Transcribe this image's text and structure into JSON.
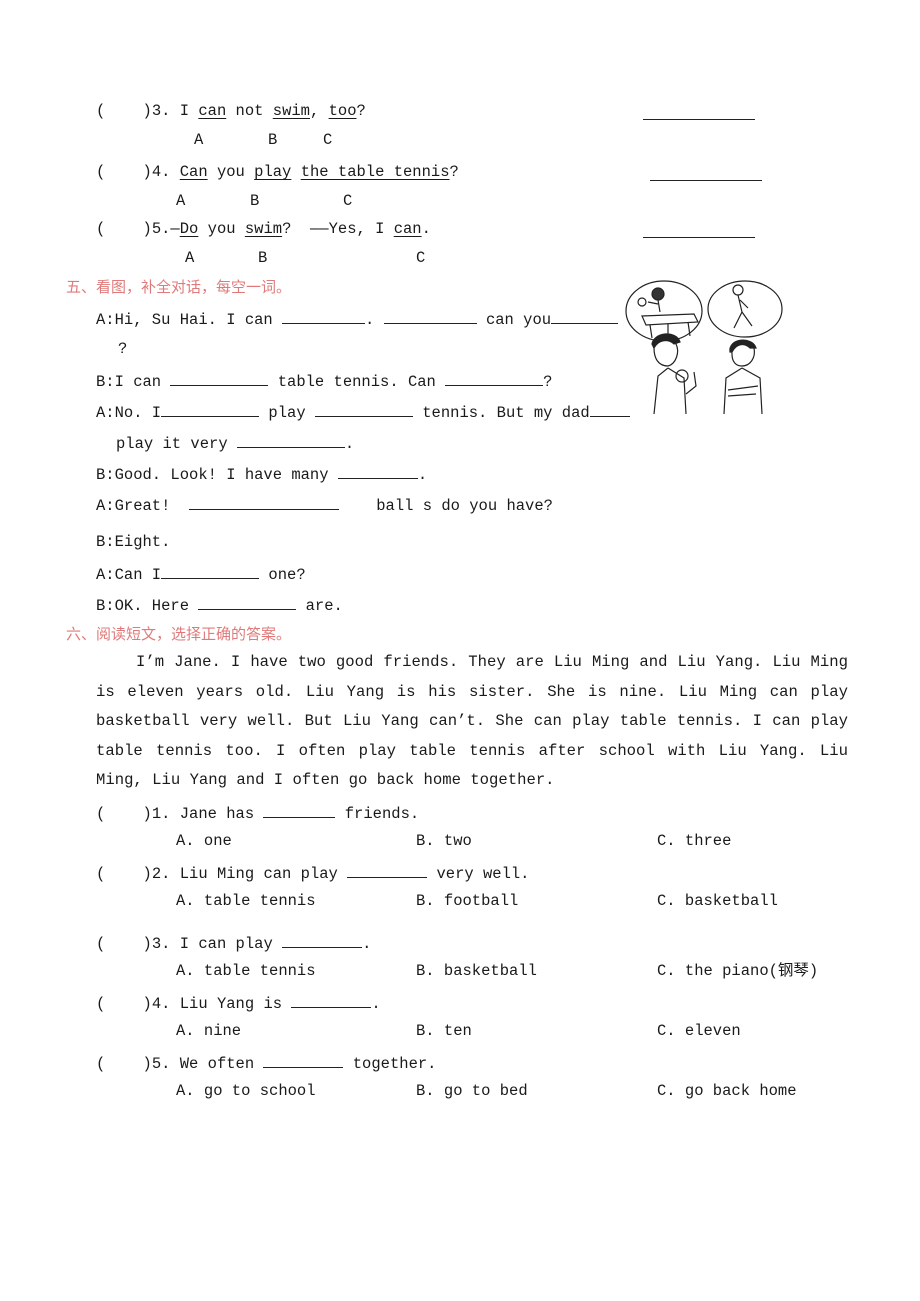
{
  "section4": {
    "items": [
      {
        "paren": "(    )",
        "num": "3.",
        "parts": [
          "I ",
          "can",
          " not ",
          "swim",
          ", ",
          "too",
          "?"
        ],
        "letters": [
          "A",
          "B",
          "C"
        ]
      },
      {
        "paren": "(    )",
        "num": "4.",
        "parts": [
          "Can",
          " you ",
          "play",
          " ",
          "the table tennis",
          "?"
        ],
        "letters": [
          "A",
          "B",
          "C"
        ]
      },
      {
        "paren": "(    )",
        "num": "5.",
        "parts": [
          "—",
          "Do",
          " you ",
          "swim",
          "?  ——Yes, I ",
          "can",
          "."
        ],
        "letters": [
          "A",
          "B",
          "C"
        ]
      }
    ]
  },
  "section5": {
    "heading": "五、看图，补全对话，每空一词。",
    "lines": {
      "l1a": "A:Hi, Su Hai. I can ",
      "l1b": ". ",
      "l1c": " can you",
      "l1d": "?",
      "l2a": "B:I can ",
      "l2b": " table tennis. Can ",
      "l2c": "?",
      "l3a": "A:No. I",
      "l3b": " play ",
      "l3c": " tennis. But my dad",
      "l4a": "play it very ",
      "l4b": ".",
      "l5a": "B:Good. Look! I have many ",
      "l5b": ".",
      "l6a": "A:Great!  ",
      "l6b": "    ball s do you have?",
      "l7": "B:Eight.",
      "l8a": "A:Can I",
      "l8b": " one?",
      "l9a": "B:OK. Here ",
      "l9b": " are."
    },
    "picture": "illustration of girl playing table tennis, boy running, girl holding ball, boy with arms crossed"
  },
  "section6": {
    "heading": "六、阅读短文，选择正确的答案。",
    "passage": "I’m Jane. I have two good friends. They are Liu Ming and Liu Yang. Liu Ming is eleven years old. Liu Yang is his sister. She is nine. Liu Ming can play basketball very well. But Liu Yang can’t. She can play table tennis. I can play table tennis too. I often play table tennis after school with Liu Yang. Liu Ming, Liu Yang and I often go back home together.",
    "questions": [
      {
        "paren": "(    )",
        "num": "1.",
        "before": "Jane has ",
        "after": " friends.",
        "options": [
          "A. one",
          "B. two",
          "C. three"
        ]
      },
      {
        "paren": "(    )",
        "num": "2.",
        "before": "Liu Ming can play ",
        "after": " very well.",
        "options": [
          "A. table tennis",
          "B. football",
          "C. basketball"
        ]
      },
      {
        "paren": "(    )",
        "num": "3.",
        "before": "I can play ",
        "after": ".",
        "options": [
          "A. table tennis",
          "B. basketball",
          "C. the piano(钢琴)"
        ]
      },
      {
        "paren": "(    )",
        "num": "4.",
        "before": "Liu Yang is ",
        "after": ".",
        "options": [
          "A. nine",
          "B. ten",
          "C. eleven"
        ]
      },
      {
        "paren": "(    )",
        "num": "5.",
        "before": "We often ",
        "after": " together.",
        "options": [
          "A. go to school",
          "B. go to bed",
          "C. go back home"
        ]
      }
    ]
  }
}
